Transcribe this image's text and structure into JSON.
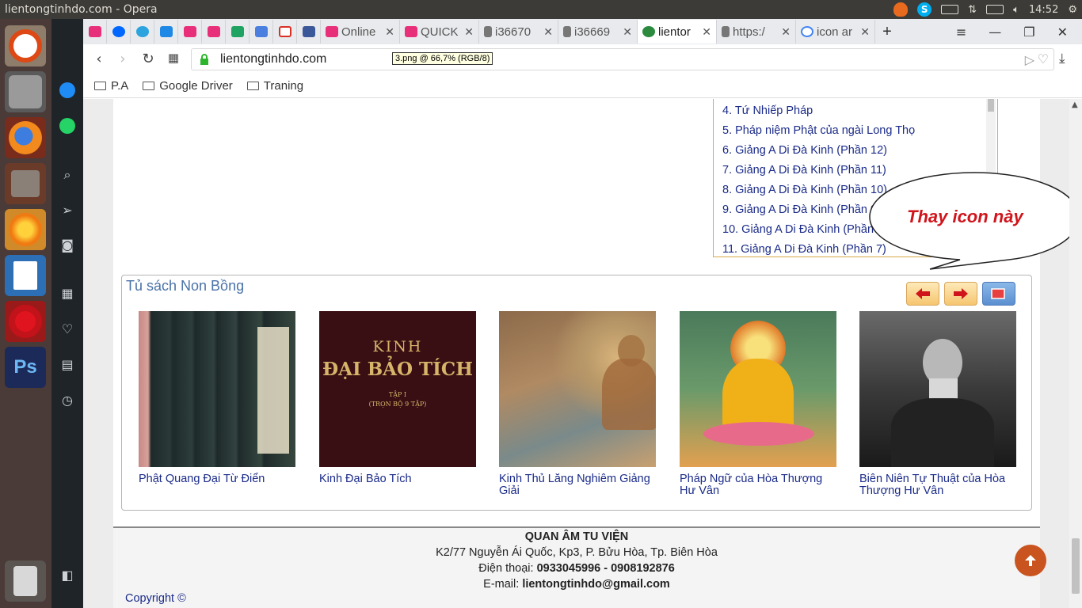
{
  "topbar": {
    "window_title": "lientongtinhdo.com - Opera",
    "clock": "14:52"
  },
  "tabs": [
    {
      "label": "",
      "icon": "pinned-tab-icon"
    },
    {
      "label": "",
      "icon": "zalo-icon"
    },
    {
      "label": "",
      "icon": "telegram-icon"
    },
    {
      "label": "",
      "icon": "chat-icon"
    },
    {
      "label": "",
      "icon": "pinned-tab-icon"
    },
    {
      "label": "",
      "icon": "pinned-tab-icon"
    },
    {
      "label": "",
      "icon": "sheets-icon"
    },
    {
      "label": "",
      "icon": "translate-icon"
    },
    {
      "label": "",
      "icon": "gmail-icon"
    },
    {
      "label": "",
      "icon": "facebook-icon"
    },
    {
      "label": "Online",
      "icon": "pinned-tab-icon"
    },
    {
      "label": "QUICK",
      "icon": "pinned-tab-icon"
    },
    {
      "label": "i36670",
      "icon": "doc-icon"
    },
    {
      "label": "i36669",
      "icon": "doc-icon"
    },
    {
      "label": "lientor",
      "icon": "site-icon",
      "active": true
    },
    {
      "label": "https:/",
      "icon": "doc-icon"
    },
    {
      "label": "icon ar",
      "icon": "google-icon"
    }
  ],
  "address": {
    "url": "lientongtinhdo.com",
    "tooltip": "3.png @ 66,7% (RGB/8)"
  },
  "bookmarks": [
    "P.A",
    "Google Driver",
    "Traning"
  ],
  "lectures": [
    "4. Tứ Nhiếp Pháp",
    "5. Pháp niệm Phật của ngài Long Thọ",
    "6. Giảng A Di Đà Kinh (Phần 12)",
    "7. Giảng A Di Đà Kinh (Phần 11)",
    "8. Giảng A Di Đà Kinh (Phần 10)",
    "9. Giảng A Di Đà Kinh (Phần 9)",
    "10. Giảng A Di Đà Kinh (Phần 8)",
    "11. Giảng A Di Đà Kinh (Phần 7)"
  ],
  "balloon": {
    "text": "Thay icon này"
  },
  "shelf": {
    "title": "Tủ sách Non Bồng",
    "books": [
      {
        "title": "Phật Quang Đại Từ Điển"
      },
      {
        "title": "Kinh Đại Bảo Tích",
        "cover_text": [
          "KINH",
          "ĐẠI BẢO TÍCH",
          "TẬP I",
          "(TRỌN BỘ 9 TẬP)"
        ]
      },
      {
        "title": "Kinh Thủ Lăng Nghiêm Giảng Giải"
      },
      {
        "title": "Pháp Ngữ của Hòa Thượng Hư Vân"
      },
      {
        "title": "Biên Niên Tự Thuật của Hòa Thượng Hư Vân"
      }
    ]
  },
  "footer": {
    "name": "QUAN ÂM TU VIỆN",
    "address": "K2/77 Nguyễn Ái Quốc, Kp3, P. Bửu Hòa, Tp. Biên Hòa",
    "phone_label": "Điện thoại: ",
    "phone": "0933045996 - 0908192876",
    "email_label": "E-mail: ",
    "email": "lientongtinhdo@gmail.com",
    "copyright": "Copyright ©"
  },
  "colors": {
    "accent_link": "#1a2b88",
    "shelf_title": "#4a72a8",
    "balloon_text": "#d0141b",
    "scroll_top_button": "#c9541f"
  }
}
